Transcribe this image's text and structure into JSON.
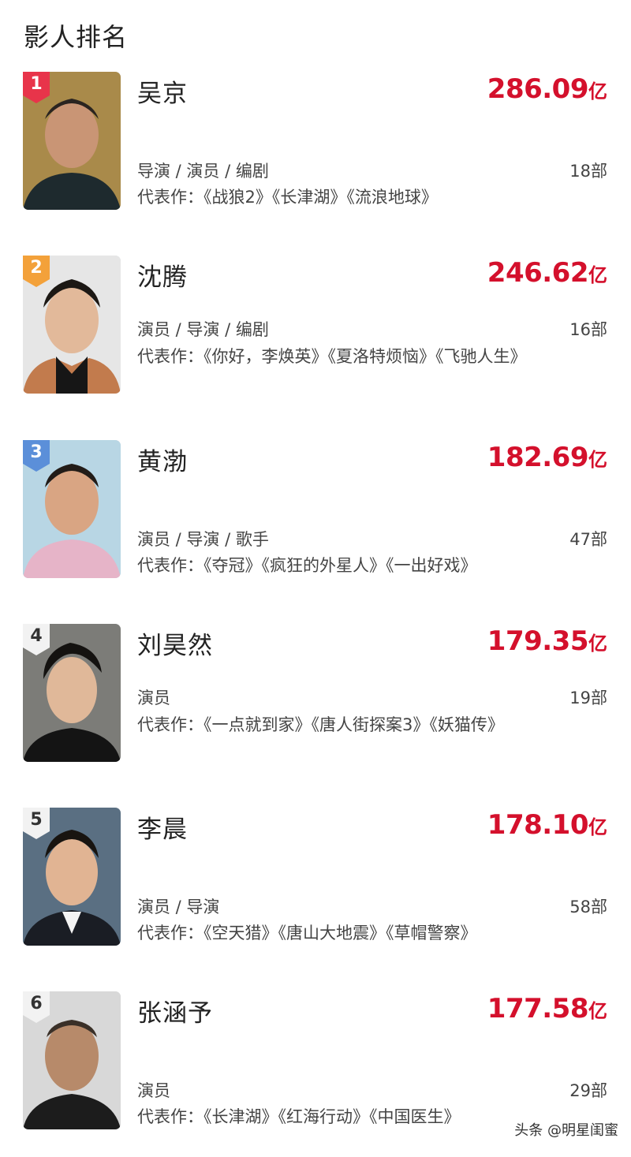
{
  "page": {
    "title": "影人排名"
  },
  "colors": {
    "accent": "#d4102c",
    "rank1": "#e8344a",
    "rank2": "#f3a13a",
    "rank3": "#5b8fd9",
    "rankOther": "#f2f2f2"
  },
  "people": [
    {
      "rank": "1",
      "name": "吴京",
      "box_office": "286.09",
      "unit": "亿",
      "roles": "导演 / 演员 / 编剧",
      "count": "18部",
      "works": "代表作：《战狼2》《长津湖》《流浪地球》"
    },
    {
      "rank": "2",
      "name": "沈腾",
      "box_office": "246.62",
      "unit": "亿",
      "roles": "演员 / 导演 / 编剧",
      "count": "16部",
      "works": "代表作：《你好，李焕英》《夏洛特烦恼》《飞驰人生》"
    },
    {
      "rank": "3",
      "name": "黄渤",
      "box_office": "182.69",
      "unit": "亿",
      "roles": "演员 / 导演 / 歌手",
      "count": "47部",
      "works": "代表作：《夺冠》《疯狂的外星人》《一出好戏》"
    },
    {
      "rank": "4",
      "name": "刘昊然",
      "box_office": "179.35",
      "unit": "亿",
      "roles": "演员",
      "count": "19部",
      "works": "代表作：《一点就到家》《唐人街探案3》《妖猫传》"
    },
    {
      "rank": "5",
      "name": "李晨",
      "box_office": "178.10",
      "unit": "亿",
      "roles": "演员 / 导演",
      "count": "58部",
      "works": "代表作：《空天猎》《唐山大地震》《草帽警察》"
    },
    {
      "rank": "6",
      "name": "张涵予",
      "box_office": "177.58",
      "unit": "亿",
      "roles": "演员",
      "count": "29部",
      "works": "代表作：《长津湖》《红海行动》《中国医生》"
    }
  ],
  "watermark": {
    "icon": "toutiao-icon",
    "text": "头条 @明星闺蜜"
  }
}
